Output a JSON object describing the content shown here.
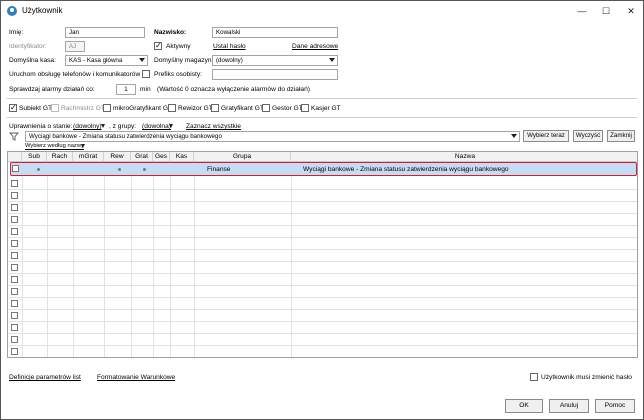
{
  "window": {
    "title": "Użytkownik",
    "minimize": "—",
    "maximize": "☐",
    "close": "✕"
  },
  "form": {
    "imie_label": "Imię:",
    "imie_value": "Jan",
    "nazwisko_label": "Nazwisko:",
    "nazwisko_value": "Kowalski",
    "identyfikator_label": "Identyfikator:",
    "identyfikator_value": "AJ",
    "aktywny_label": "Aktywny",
    "ustal_haslo": "Ustal hasło",
    "dane_adresowe": "Dane adresowe",
    "kasa_label": "Domyślna kasa:",
    "kasa_value": "KAS - Kasa główna",
    "magazyn_label": "Domyślny magazyn:",
    "magazyn_value": "(dowolny)",
    "telefony_label": "Uruchom obsługę telefonów i komunikatorów",
    "prefiks_label": "Prefiks osobisty:",
    "alarmy_label": "Sprawdzaj alarmy działań co:",
    "alarmy_value": "1",
    "alarmy_unit": "min",
    "alarmy_note": "(Wartość 0 oznacza wyłączenie alarmów do działań)"
  },
  "roles": [
    {
      "label": "Subiekt GT",
      "checked": true,
      "disabled": false
    },
    {
      "label": "Rachmistrz GT",
      "checked": false,
      "disabled": true
    },
    {
      "label": "mikroGratyfikant GT",
      "checked": false,
      "disabled": false
    },
    {
      "label": "Rewizor GT",
      "checked": false,
      "disabled": false
    },
    {
      "label": "Gratyfikant GT",
      "checked": false,
      "disabled": false
    },
    {
      "label": "Gestor GT",
      "checked": false,
      "disabled": false
    },
    {
      "label": "Kasjer GT",
      "checked": false,
      "disabled": false
    }
  ],
  "permissions": {
    "w_stanie_label": "Uprawnienia o stanie:",
    "w_stanie_value": "(dowolny)",
    "grupy_label": ", z grupy:",
    "grupy_value": "(dowolna)",
    "zaznacz": "Zaznacz wszystkie",
    "search_value": "Wyciągi bankowe - Zmiana statusu zatwierdzenia wyciągu bankowego",
    "wybierz_teraz": "Wybierz teraz",
    "wyczysc": "Wyczyść",
    "zamknij": "Zamknij",
    "sort_label": "Wybierz według nazwy"
  },
  "grid": {
    "columns": [
      "Sub",
      "Rach",
      "mGrat",
      "Rew",
      "Grat",
      "Ges",
      "Kas",
      "Grupa",
      "Nazwa"
    ],
    "selected_row": {
      "grupa": "Finanse",
      "nazwa": "Wyciągi bankowe - Zmiana statusu zatwierdzenia wyciągu bankowego"
    }
  },
  "footer": {
    "definicje": "Definicje parametrów list",
    "formatowanie": "Formatowanie Warunkowe",
    "musi_zmienic": "Użytkownik musi zmienić hasło",
    "ok": "OK",
    "anuluj": "Anuluj",
    "pomoc": "Pomoc"
  }
}
